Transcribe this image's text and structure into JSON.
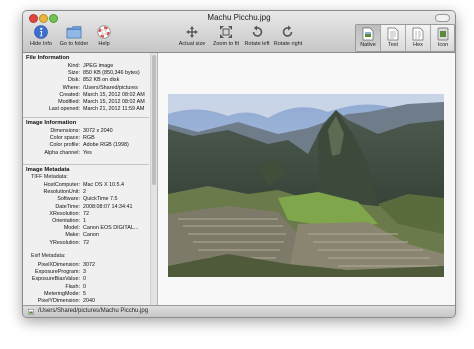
{
  "window": {
    "title": "Machu Picchu.jpg"
  },
  "toolbar": {
    "hide_info": "Hide Info",
    "go_to_folder": "Go to folder",
    "help": "Help",
    "actual_size": "Actual size",
    "zoom_to_fit": "Zoom to fit",
    "rotate_left": "Rotate left",
    "rotate_right": "Rotate right",
    "view_modes": [
      "Native",
      "Text",
      "Hex",
      "Icon"
    ],
    "active_view": "Native"
  },
  "file_info": {
    "heading": "File Information",
    "rows": [
      {
        "k": "Kind:",
        "v": "JPEG image"
      },
      {
        "k": "Size:",
        "v": "850 KB (850,346 bytes)"
      },
      {
        "k": "Disk:",
        "v": "852 KB on disk"
      },
      {
        "k": "Where:",
        "v": "/Users/Shared/pictures"
      },
      {
        "k": "Created:",
        "v": "March 15, 2012 08:02 AM"
      },
      {
        "k": "Modified:",
        "v": "March 15, 2012 08:02 AM"
      },
      {
        "k": "Last opened:",
        "v": "March 21, 2012 11:59 AM"
      }
    ]
  },
  "image_info": {
    "heading": "Image Information",
    "rows": [
      {
        "k": "Dimensions:",
        "v": "3072 x 2040"
      },
      {
        "k": "Color space:",
        "v": "RGB"
      },
      {
        "k": "Color profile:",
        "v": "Adobe RGB (1998)"
      },
      {
        "k": "Alpha channel:",
        "v": "Yes"
      }
    ]
  },
  "image_metadata": {
    "heading": "Image Metadata",
    "tiff_label": "TIFF Metadata:",
    "tiff_rows": [
      {
        "k": "HostComputer:",
        "v": "Mac OS X 10.5.4"
      },
      {
        "k": "ResolutionUnit:",
        "v": "2"
      },
      {
        "k": "Software:",
        "v": "QuickTime 7.5"
      },
      {
        "k": "DateTime:",
        "v": "2008:08:07 14:34:41"
      },
      {
        "k": "XResolution:",
        "v": "72"
      },
      {
        "k": "Orientation:",
        "v": "1"
      },
      {
        "k": "Model:",
        "v": "Canon EOS DIGITAL..."
      },
      {
        "k": "Make:",
        "v": "Canon"
      },
      {
        "k": "YResolution:",
        "v": "72"
      }
    ],
    "exif_label": "Exif Metadata:",
    "exif_rows": [
      {
        "k": "PixelXDimension:",
        "v": "3072"
      },
      {
        "k": "ExposureProgram:",
        "v": "3"
      },
      {
        "k": "ExposureBiasValue:",
        "v": "0"
      },
      {
        "k": "Flash:",
        "v": "0"
      },
      {
        "k": "MeteringMode:",
        "v": "5"
      },
      {
        "k": "PixelYDimension:",
        "v": "2040"
      }
    ]
  },
  "status": {
    "path": "/Users/Shared/pictures/Machu Picchu.jpg"
  },
  "colors": {
    "accent": "#3b6fd0",
    "sky": "#9fb6d8",
    "grass": "#7a9a45"
  },
  "icons": [
    "info-icon",
    "folder-icon",
    "help-icon",
    "actual-size-icon",
    "zoom-to-fit-icon",
    "rotate-left-icon",
    "rotate-right-icon",
    "native-icon",
    "text-icon",
    "hex-icon",
    "icon-view-icon",
    "image-file-icon"
  ]
}
